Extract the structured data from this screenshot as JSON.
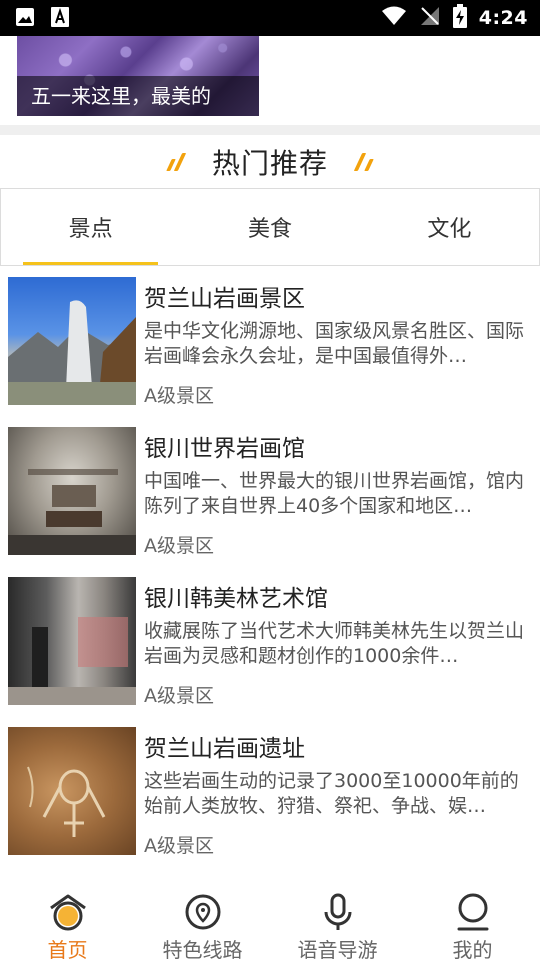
{
  "status_bar": {
    "time": "4:24",
    "left_icons": [
      "image-icon",
      "font-a-icon"
    ],
    "right_icons": [
      "wifi-icon",
      "signal-off-icon",
      "battery-charging-icon"
    ]
  },
  "banner": {
    "caption": "五一来这里，最美的"
  },
  "section": {
    "title": "热门推荐"
  },
  "tabs": [
    {
      "label": "景点",
      "active": true
    },
    {
      "label": "美食",
      "active": false
    },
    {
      "label": "文化",
      "active": false
    }
  ],
  "items": [
    {
      "title": "贺兰山岩画景区",
      "desc": "是中华文化溯源地、国家级风景名胜区、国际岩画峰会永久会址，是中国最值得外…",
      "tag": "A级景区"
    },
    {
      "title": "银川世界岩画馆",
      "desc": "中国唯一、世界最大的银川世界岩画馆，馆内陈列了来自世界上40多个国家和地区…",
      "tag": "A级景区"
    },
    {
      "title": "银川韩美林艺术馆",
      "desc": "收藏展陈了当代艺术大师韩美林先生以贺兰山岩画为灵感和题材创作的1000余件…",
      "tag": "A级景区"
    },
    {
      "title": "贺兰山岩画遗址",
      "desc": "这些岩画生动的记录了3000至10000年前的始前人类放牧、狩猎、祭祀、争战、娱…",
      "tag": "A级景区"
    }
  ],
  "bottom_nav": [
    {
      "label": "首页",
      "icon": "home-icon",
      "active": true
    },
    {
      "label": "特色线路",
      "icon": "route-icon",
      "active": false
    },
    {
      "label": "语音导游",
      "icon": "microphone-icon",
      "active": false
    },
    {
      "label": "我的",
      "icon": "profile-icon",
      "active": false
    }
  ],
  "colors": {
    "accent": "#e8791a",
    "tab_indicator": "#f5c21b",
    "title_slash": "#f2a20d"
  }
}
